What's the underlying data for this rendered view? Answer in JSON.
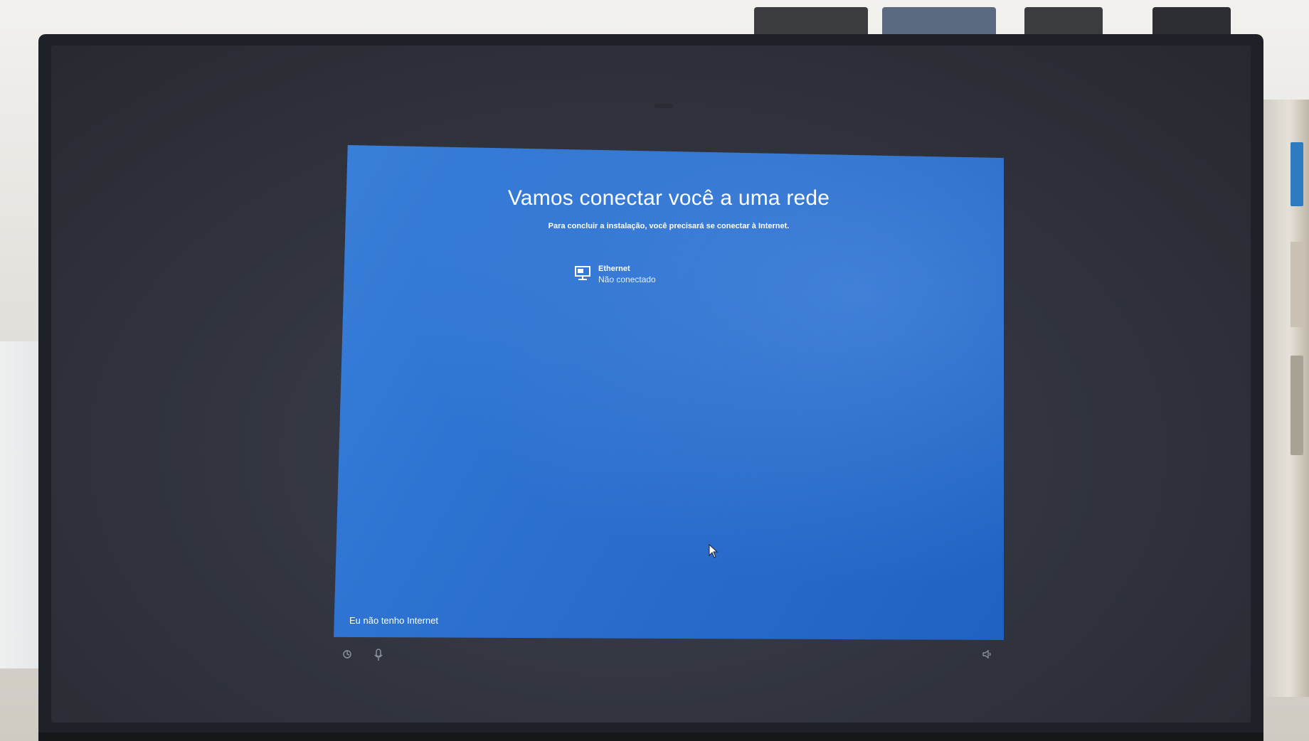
{
  "oobe": {
    "title": "Vamos conectar você a uma rede",
    "subtitle": "Para concluir a instalação, você precisará se conectar à Internet.",
    "network": {
      "name": "Ethernet",
      "status": "Não conectado",
      "icon": "ethernet-monitor-icon"
    },
    "skip_link": "Eu não tenho Internet"
  },
  "bottom_bar": {
    "icons": [
      "ease-of-access-icon",
      "microphone-icon",
      "volume-icon"
    ]
  },
  "colors": {
    "oobe_blue": "#2a6ccc",
    "bezel": "#1f2128",
    "text": "#ffffff"
  }
}
